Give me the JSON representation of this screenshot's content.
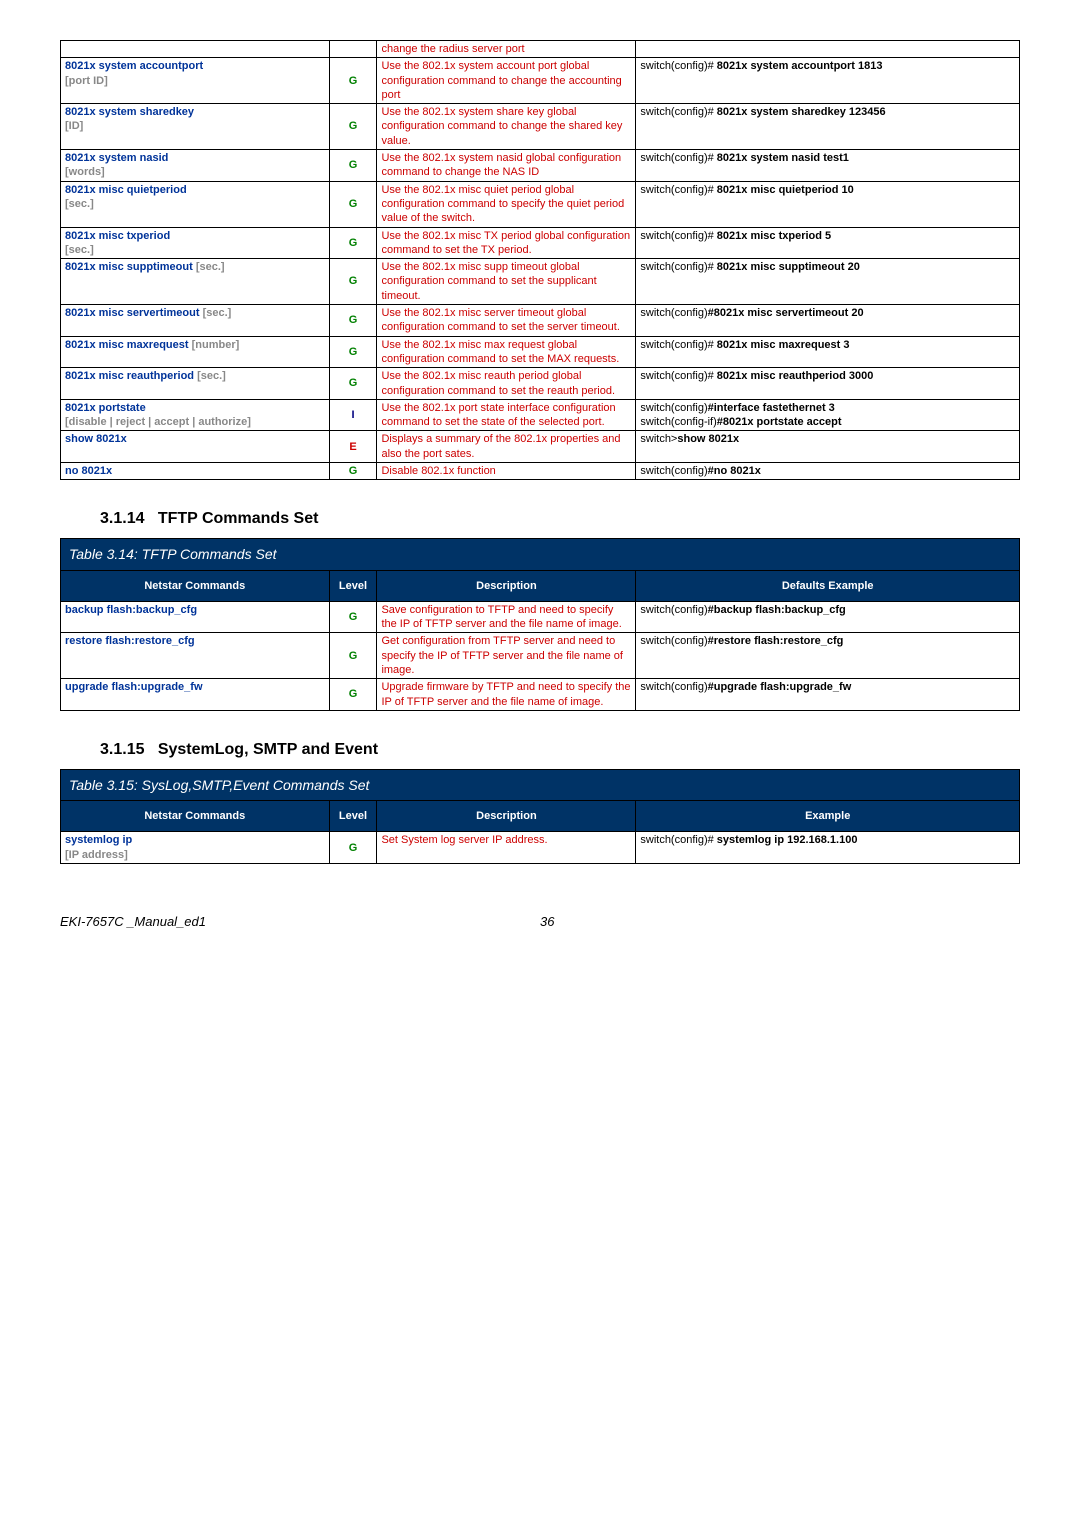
{
  "table1": {
    "rows": [
      {
        "cmd": "",
        "param": "",
        "lvl": "",
        "lvlClass": "",
        "desc": "change the radius server port",
        "ex": "",
        "exBold": ""
      },
      {
        "cmd": "8021x system accountport",
        "param": "[port ID]",
        "lvl": "G",
        "lvlClass": "lvl-G",
        "desc": "Use the 802.1x system account port global configuration command to change the accounting port",
        "ex": "switch(config)# ",
        "exBold": "8021x system accountport  1813"
      },
      {
        "cmd": "8021x system sharedkey",
        "param": "[ID]",
        "lvl": "G",
        "lvlClass": "lvl-G",
        "desc": "Use the 802.1x system share key global configuration command to change the shared key value.",
        "ex": "switch(config)# ",
        "exBold": "8021x system sharedkey 123456"
      },
      {
        "cmd": "8021x system nasid",
        "param": "[words]",
        "lvl": "G",
        "lvlClass": "lvl-G",
        "desc": "Use the 802.1x system nasid global configuration command to change the NAS ID",
        "ex": "switch(config)# ",
        "exBold": "8021x system nasid test1"
      },
      {
        "cmd": "8021x misc quietperiod",
        "param": " [sec.]",
        "lvl": "G",
        "lvlClass": "lvl-G",
        "desc": "Use the 802.1x misc quiet period global configuration command to specify the quiet period value of the switch.",
        "ex": "switch(config)# ",
        "exBold": "8021x misc quietperiod 10"
      },
      {
        "cmd": "8021x misc txperiod",
        "param": "[sec.]",
        "lvl": "G",
        "lvlClass": "lvl-G",
        "desc": "Use the 802.1x misc TX period global configuration command to set the TX period.",
        "ex": "switch(config)# ",
        "exBold": "8021x misc txperiod 5"
      },
      {
        "cmd": "8021x misc supptimeout",
        "param": "[sec.]",
        "paramInline": true,
        "lvl": "G",
        "lvlClass": "lvl-G",
        "desc": "Use the 802.1x misc supp timeout global configuration command to set the supplicant timeout.",
        "ex": "switch(config)# ",
        "exBold": "8021x misc supptimeout 20"
      },
      {
        "cmd": "8021x misc servertimeout ",
        "param": " [sec.]",
        "paramInline": true,
        "lvl": "G",
        "lvlClass": "lvl-G",
        "desc": "Use the 802.1x misc server timeout global configuration command to set the server timeout.",
        "ex": "switch(config)",
        "exBold": "#8021x misc servertimeout 20"
      },
      {
        "cmd": "8021x misc maxrequest",
        "param": "[number]",
        "paramInline": true,
        "lvl": "G",
        "lvlClass": "lvl-G",
        "desc": "Use the 802.1x misc max request global configuration command to set the MAX requests.",
        "ex": "switch(config)# ",
        "exBold": "8021x misc maxrequest 3"
      },
      {
        "cmd": "8021x misc  reauthperiod",
        "param": "[sec.]",
        "paramInline": true,
        "lvl": "G",
        "lvlClass": "lvl-G",
        "desc": "Use the 802.1x misc reauth period global configuration command to set the reauth period.",
        "ex": "switch(config)# ",
        "exBold": "8021x misc reauthperiod 3000"
      },
      {
        "cmd": "8021x  portstate",
        "param": "[disable | reject | accept | authorize]",
        "lvl": "I",
        "lvlClass": "lvl-I",
        "desc": "Use the 802.1x port state interface configuration command to set the state of the selected port.",
        "exMulti": [
          [
            "switch(config)",
            "#interface fastethernet 3"
          ],
          [
            "switch(config-if)",
            "#8021x portstate accept"
          ]
        ]
      },
      {
        "cmd": "show 8021x",
        "param": "",
        "lvl": "E",
        "lvlClass": "lvl-E",
        "desc": "Displays a summary of the 802.1x properties and also the port sates.",
        "ex": "switch>",
        "exBold": "show 8021x"
      },
      {
        "cmd": "no 8021x",
        "param": "",
        "lvl": "G",
        "lvlClass": "lvl-G",
        "desc": "Disable 802.1x function",
        "ex": "switch(config)",
        "exBold": "#no 8021x"
      }
    ]
  },
  "section14": {
    "num": "3.1.14",
    "title": "TFTP Commands Set",
    "tableTitle": "Table 3.14: TFTP  Commands Set",
    "headers": {
      "cmd": "Netstar Commands",
      "lvl": "Level",
      "desc": "Description",
      "ex": "Defaults Example"
    },
    "rows": [
      {
        "cmd": "backup flash:backup_cfg",
        "lvl": "G",
        "lvlClass": "lvl-G",
        "desc": "Save configuration to TFTP and need to specify the IP of TFTP server and the file name of image.",
        "ex": "switch(config)",
        "exBold": "#backup flash:backup_cfg"
      },
      {
        "cmd": "restore flash:restore_cfg",
        "lvl": "G",
        "lvlClass": "lvl-G",
        "desc": "Get configuration from TFTP server and need to specify the IP of TFTP server and the file name of image.",
        "ex": "switch(config)",
        "exBold": "#restore flash:restore_cfg"
      },
      {
        "cmd": "upgrade flash:upgrade_fw",
        "lvl": "G",
        "lvlClass": "lvl-G",
        "desc": "Upgrade firmware by TFTP and need to specify the IP of TFTP server and the file name of image.",
        "ex": "switch(config)",
        "exBold": "#upgrade flash:upgrade_fw"
      }
    ]
  },
  "section15": {
    "num": "3.1.15",
    "title": "SystemLog, SMTP and Event",
    "tableTitle": "Table 3.15: SysLog,SMTP,Event  Commands Set",
    "headers": {
      "cmd": "Netstar Commands",
      "lvl": "Level",
      "desc": "Description",
      "ex": "Example"
    },
    "rows": [
      {
        "cmd": "systemlog ip",
        "param": "[IP address]",
        "lvl": "G",
        "lvlClass": "lvl-G",
        "desc": "Set System log server IP address.",
        "ex": "switch(config)# ",
        "exBold": "systemlog ip 192.168.1.100"
      }
    ]
  },
  "footer": {
    "left": "EKI-7657C _Manual_ed1",
    "page": "36"
  }
}
